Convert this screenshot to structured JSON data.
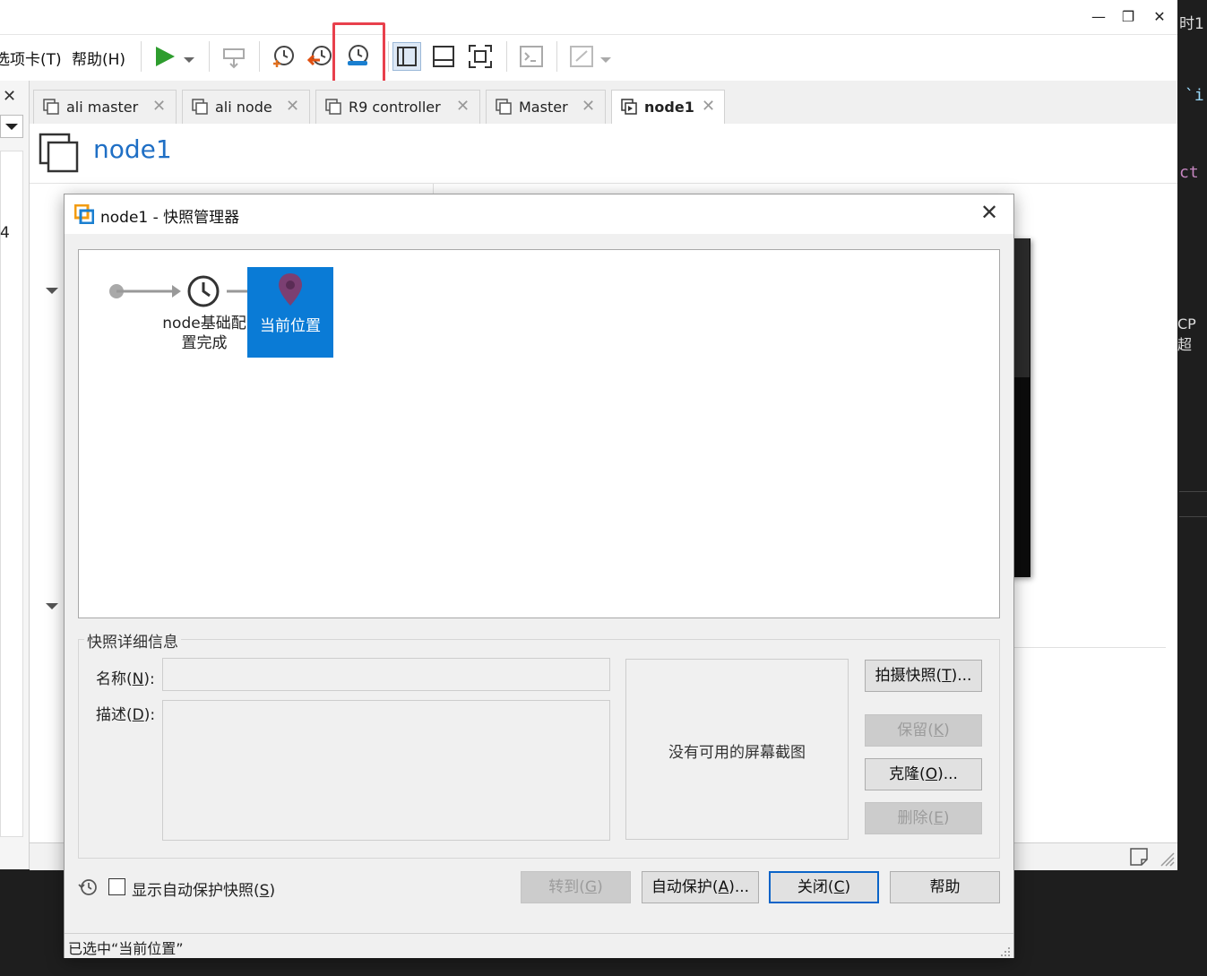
{
  "menu": {
    "tabs_label": "选项卡(T)",
    "help_label": "帮助(H)"
  },
  "tabs": [
    {
      "label": "ali master"
    },
    {
      "label": "ali node"
    },
    {
      "label": "R9 controller"
    },
    {
      "label": "Master"
    },
    {
      "label": "node1"
    }
  ],
  "vm": {
    "title": "node1",
    "left_snippet": "4"
  },
  "code_snippets": [
    "时1",
    "`i",
    "ct",
    "CP超"
  ],
  "dialog": {
    "title": "node1 - 快照管理器",
    "snapshot_name": "node基础配置完成",
    "snapshot_name_line1": "node基础配",
    "snapshot_name_line2": "置完成",
    "current_position": "当前位置",
    "details_group": "快照详细信息",
    "name_label": "名称",
    "name_key": "N",
    "desc_label": "描述",
    "desc_key": "D",
    "no_screenshot": "没有可用的屏幕截图",
    "buttons": {
      "take": {
        "pre": "拍摄快照(",
        "key": "T",
        "post": ")..."
      },
      "keep": {
        "pre": "保留(",
        "key": "K",
        "post": ")"
      },
      "clone": {
        "pre": "克隆(",
        "key": "O",
        "post": ")..."
      },
      "delete": {
        "pre": "删除(",
        "key": "E",
        "post": ")"
      },
      "goto": {
        "pre": "转到(",
        "key": "G",
        "post": ")"
      },
      "autoprotect": {
        "pre": "自动保护(",
        "key": "A",
        "post": ")..."
      },
      "close": {
        "pre": "关闭(",
        "key": "C",
        "post": ")"
      },
      "help": "帮助"
    },
    "show_autoprotect": {
      "pre": "显示自动保护快照(",
      "key": "S",
      "post": ")"
    },
    "status": "已选中“当前位置”"
  },
  "colors": {
    "accent": "#0a7bd6",
    "title_blue": "#1f6fc5",
    "highlight_red": "#e8404c",
    "play_green": "#2e9d2e"
  }
}
